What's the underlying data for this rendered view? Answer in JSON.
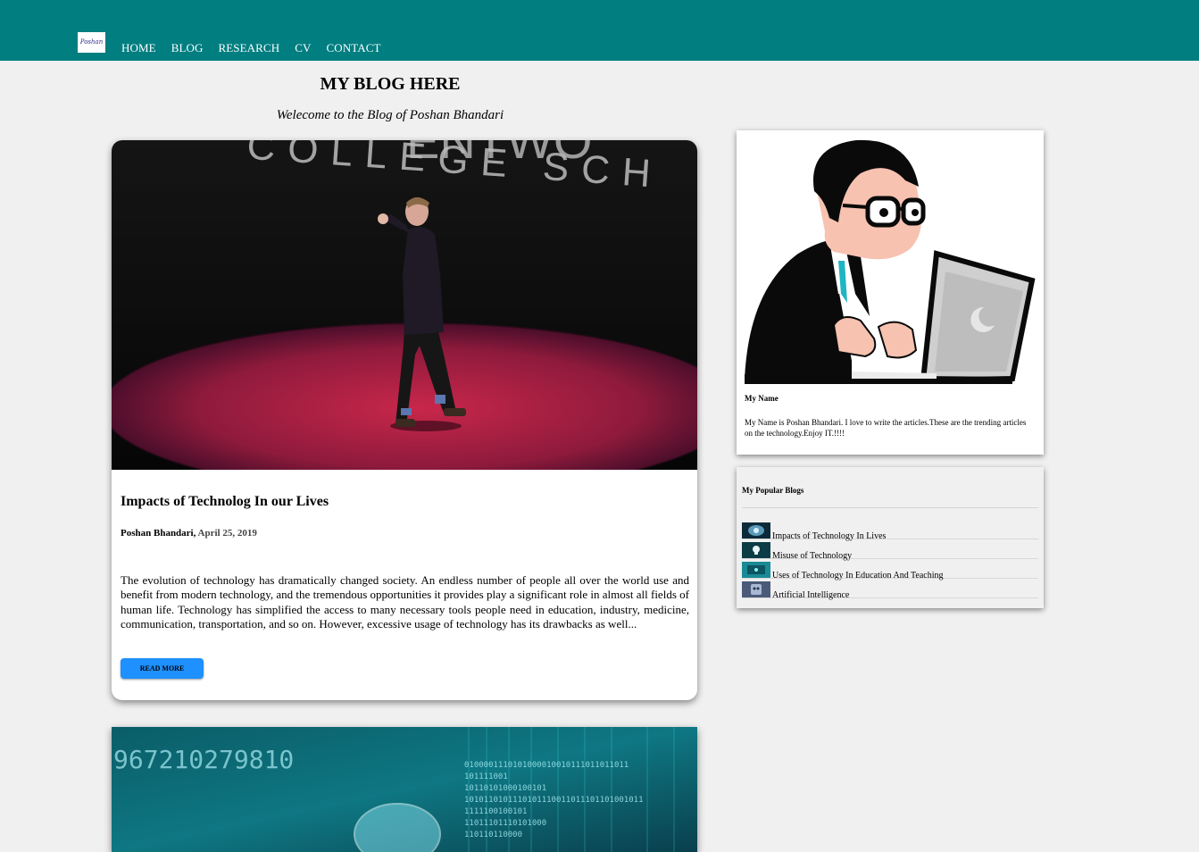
{
  "nav": {
    "logo_text": "Poshan",
    "items": [
      "HOME",
      "BLOG",
      "RESEARCH",
      "CV",
      "CONTACT"
    ]
  },
  "page": {
    "title": "MY BLOG HERE",
    "subtitle": "Welecome to the Blog of Poshan Bhandari"
  },
  "post": {
    "title": "Impacts of Technolog In our Lives",
    "author": "Poshan Bhandari,",
    "date": "April 25, 2019",
    "excerpt": "The evolution of technology has dramatically changed society. An endless number of people all over the world use and benefit from modern technology, and the tremendous opportunities it provides play a significant role in almost all fields of human life. Technology has simplified the access to many necessary tools people need in education, industry, medicine, communication, transportation, and so on. However, excessive usage of technology has its drawbacks as well...",
    "read_more_label": "READ MORE",
    "image_backdrop_text": "COLLEGE SCH",
    "image_backdrop_text_top": "ENTWO"
  },
  "post2": {
    "image_number_text": "967210279810",
    "binary_lines": [
      "0100001110101000010010111011011011",
      "101111001",
      "10110101000100101",
      "1010110101110101110011011101101001011",
      "1111100100101",
      "11011101110101000",
      "110110110000"
    ]
  },
  "profile": {
    "name_label": "My Name",
    "bio": "My Name is Poshan Bhandari. I love to write the articles.These are the trending articles on the technology.Enjoy IT.!!!!"
  },
  "popular": {
    "title": "My Popular Blogs",
    "items": [
      {
        "label": "Impacts of Technology In Lives",
        "thumb": "brain-thumb"
      },
      {
        "label": "Misuse of Technology",
        "thumb": "skull-thumb"
      },
      {
        "label": "Uses of Technology In Education And Teaching",
        "thumb": "classroom-thumb"
      },
      {
        "label": "Artificial Intelligence",
        "thumb": "robot-thumb"
      }
    ]
  },
  "colors": {
    "topbar": "#007e80",
    "background": "#f0f0f0",
    "button": "#1e90ff"
  }
}
